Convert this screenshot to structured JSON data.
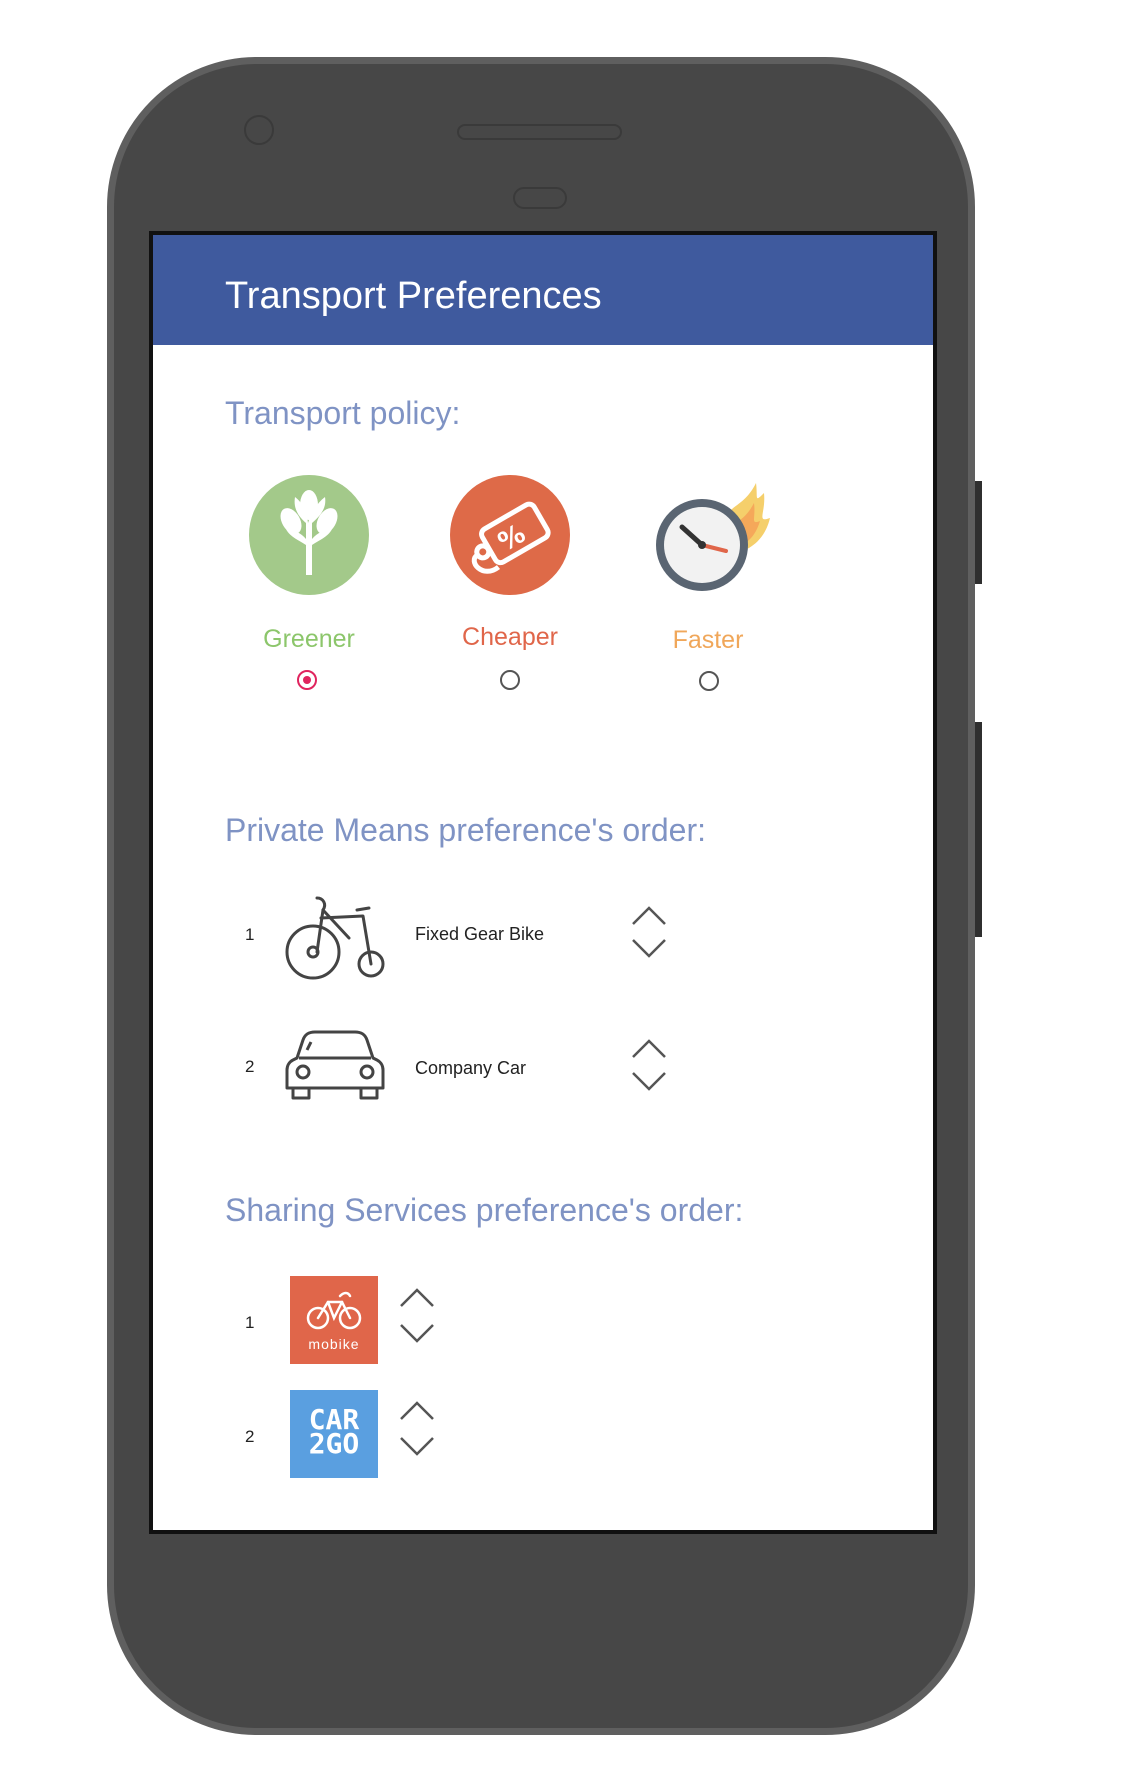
{
  "app": {
    "title": "Transport Preferences",
    "accent": "#3f5a9e"
  },
  "policy": {
    "heading": "Transport policy:",
    "options": [
      {
        "label": "Greener",
        "color": "#8cc66b",
        "icon": "tree-icon",
        "selected": true
      },
      {
        "label": "Cheaper",
        "color": "#e0664a",
        "icon": "price-tag-icon",
        "selected": false
      },
      {
        "label": "Faster",
        "color": "#f0a75a",
        "icon": "clock-fire-icon",
        "selected": false
      }
    ]
  },
  "private_means": {
    "heading": "Private Means preference's order:",
    "items": [
      {
        "rank": "1",
        "label": "Fixed Gear Bike",
        "icon": "bicycle-icon"
      },
      {
        "rank": "2",
        "label": "Company Car",
        "icon": "car-icon"
      }
    ]
  },
  "sharing_services": {
    "heading": "Sharing Services preference's order:",
    "items": [
      {
        "rank": "1",
        "logo_text": "mobike",
        "logo_color": "#e0664a",
        "icon": "mobike-logo"
      },
      {
        "rank": "2",
        "logo_text_line1": "CAR",
        "logo_text_line2": "2GO",
        "logo_color": "#5a9fe0",
        "icon": "car2go-logo"
      }
    ]
  }
}
